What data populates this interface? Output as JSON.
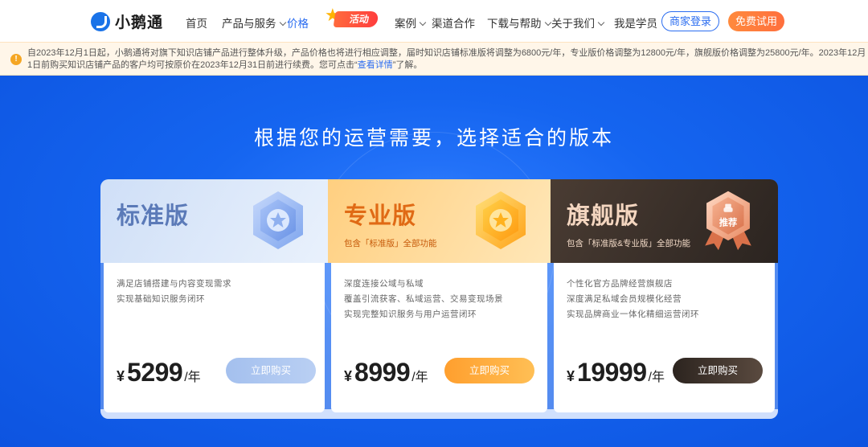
{
  "nav": {
    "logo_text": "小鹅通",
    "items": [
      {
        "label": "首页"
      },
      {
        "label": "产品与服务"
      },
      {
        "label": "价格"
      },
      {
        "label": "案例"
      },
      {
        "label": "渠道合作"
      },
      {
        "label": "下载与帮助"
      },
      {
        "label": "关于我们"
      },
      {
        "label": "我是学员"
      }
    ],
    "activity_badge": "活动",
    "login_button": "商家登录",
    "trial_button": "免费试用"
  },
  "notice": {
    "icon": "!",
    "text": "自2023年12月1日起，小鹅通将对旗下知识店铺产品进行整体升级，产品价格也将进行相应调整，届时知识店铺标准版将调整为6800元/年，专业版价格调整为12800元/年，旗舰版价格调整为25800元/年。2023年12月1日前购买知识店铺产品的客户均可按原价在2023年12月31日前进行续费。您可点击“",
    "link": "查看详情",
    "suffix": "”了解。"
  },
  "hero": {
    "headline": "根据您的运营需要，选择适合的版本"
  },
  "plans": [
    {
      "name": "标准版",
      "subtitle": "",
      "features": [
        "满足店铺搭建与内容变现需求",
        "实现基础知识服务闭环"
      ],
      "currency": "¥",
      "price": "5299",
      "unit": "/年",
      "button": "立即购买"
    },
    {
      "name": "专业版",
      "subtitle": "包含「标准版」全部功能",
      "features": [
        "深度连接公域与私域",
        "覆盖引流获客、私域运营、交易变现场景",
        "实现完整知识服务与用户运营闭环"
      ],
      "currency": "¥",
      "price": "8999",
      "unit": "/年",
      "button": "立即购买"
    },
    {
      "name": "旗舰版",
      "subtitle": "包含「标准版&专业版」全部功能",
      "badge": "推荐",
      "features": [
        "个性化官方品牌经营旗舰店",
        "深度满足私域会员规模化经营",
        "实现品牌商业一体化精细运营闭环"
      ],
      "currency": "¥",
      "price": "19999",
      "unit": "/年",
      "button": "立即购买"
    }
  ],
  "colors": {
    "brand_blue": "#2a6cf0",
    "trial_orange": "#ff7a3d",
    "standard": "#5b7ab8",
    "pro": "#e06a15",
    "flagship": "#2b2420"
  }
}
